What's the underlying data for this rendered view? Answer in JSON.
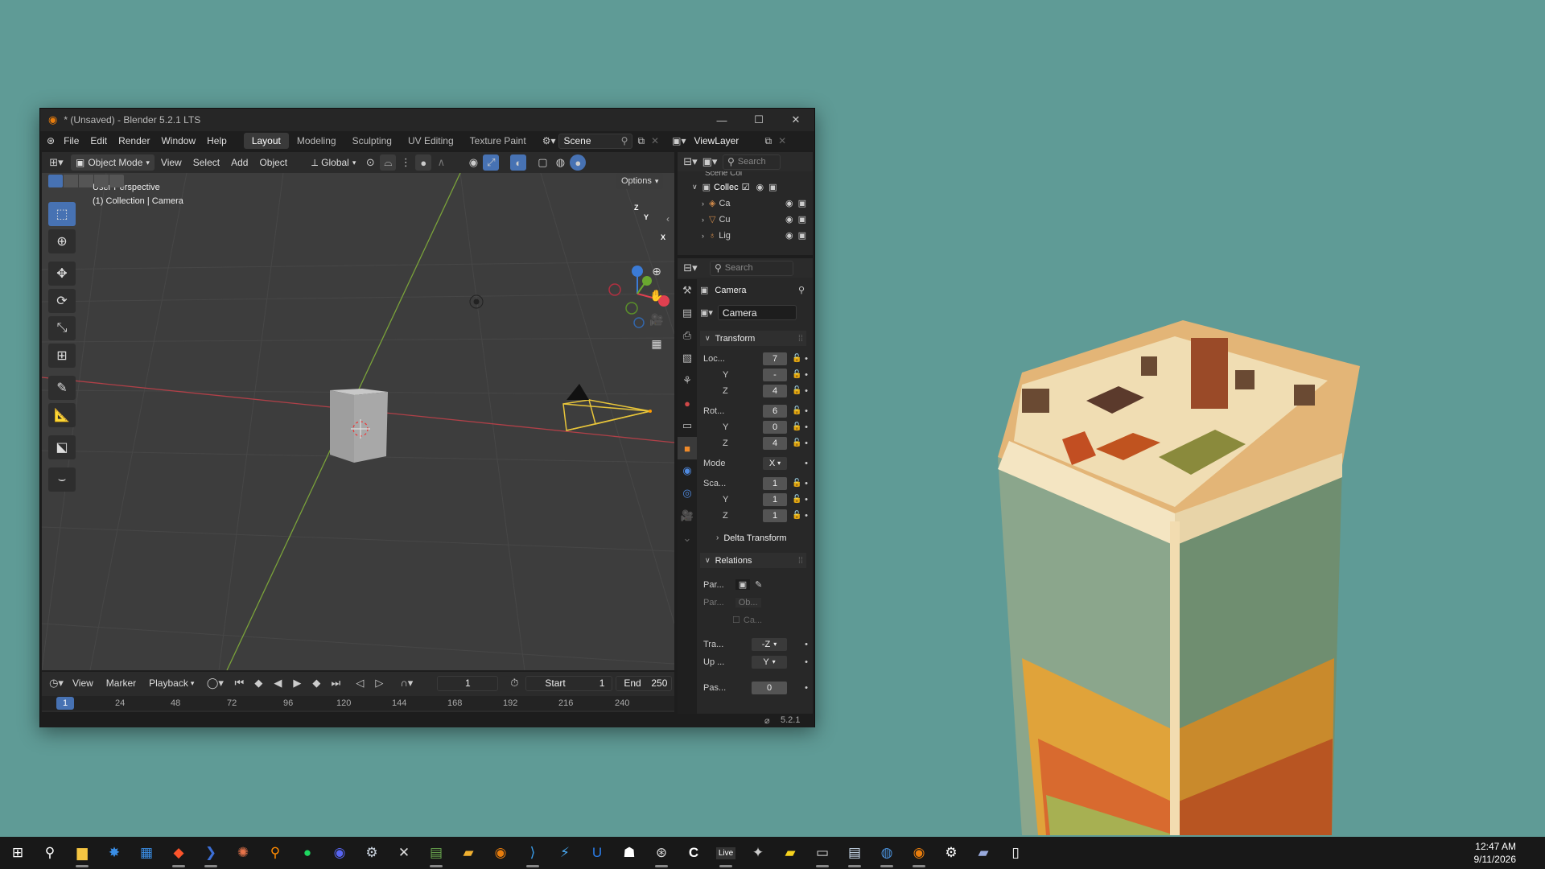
{
  "window": {
    "title": "* (Unsaved) - Blender 5.2.1 LTS",
    "min_icon": "minimize-icon",
    "max_icon": "maximize-icon",
    "close_icon": "close-icon"
  },
  "menubar": {
    "items": [
      "File",
      "Edit",
      "Render",
      "Window",
      "Help"
    ],
    "workspaces": [
      "Layout",
      "Modeling",
      "Sculpting",
      "UV Editing",
      "Texture Paint"
    ],
    "active_workspace": "Layout",
    "scene": "Scene",
    "view_layer": "ViewLayer"
  },
  "viewport_header": {
    "mode": "Object Mode",
    "menus": [
      "View",
      "Select",
      "Add",
      "Object"
    ],
    "orientation": "Global",
    "options": "Options"
  },
  "viewport": {
    "view_name": "User Perspective",
    "collection_info": "(1) Collection | Camera",
    "gizmo": {
      "x": "X",
      "y": "Y",
      "z": "Z"
    }
  },
  "outliner": {
    "search_placeholder": "Search",
    "scene_label": "Scene Col",
    "items": [
      {
        "label": "Collec",
        "icon": "collection-icon"
      },
      {
        "label": "Ca",
        "icon": "camera-icon"
      },
      {
        "label": "Cu",
        "icon": "mesh-icon"
      },
      {
        "label": "Lig",
        "icon": "light-icon"
      }
    ]
  },
  "properties": {
    "search_placeholder": "Search",
    "object_name": "Camera",
    "data_name": "Camera",
    "transform_header": "Transform",
    "location": {
      "label": "Loc...",
      "x": "7",
      "y": "-",
      "z": "4"
    },
    "rotation": {
      "label": "Rot...",
      "x": "6",
      "y": "0",
      "z": "4"
    },
    "mode": {
      "label": "Mode",
      "value": "X"
    },
    "scale": {
      "label": "Sca...",
      "x": "1",
      "y": "1",
      "z": "1"
    },
    "axis_y": "Y",
    "axis_z": "Z",
    "delta_transform": "Delta Transform",
    "relations_header": "Relations",
    "parent_label": "Par...",
    "parent_type_label": "Par...",
    "parent_type_value": "Ob...",
    "camera_parent": "Ca...",
    "track_label": "Tra...",
    "track_value": "-Z",
    "up_label": "Up ...",
    "up_value": "Y",
    "pass_label": "Pas...",
    "pass_value": "0"
  },
  "timeline": {
    "menus": [
      "View",
      "Marker",
      "Playback"
    ],
    "current_frame": "1",
    "start_label": "Start",
    "start_value": "1",
    "end_label": "End",
    "end_value": "250",
    "ticks": [
      "1",
      "24",
      "48",
      "72",
      "96",
      "120",
      "144",
      "168",
      "192",
      "216",
      "240"
    ]
  },
  "statusbar": {
    "version": "5.2.1"
  },
  "taskbar": {
    "time": "12:47 AM",
    "date": "9/11/2026",
    "icons": [
      "windows-start-icon",
      "search-icon",
      "file-explorer-icon",
      "app-icon",
      "app-icon",
      "brave-browser-icon",
      "powershell-icon",
      "app-icon",
      "search-app-icon",
      "spotify-icon",
      "discord-icon",
      "steam-icon",
      "app-icon",
      "app-icon",
      "folder-icon",
      "blender-icon",
      "vscode-icon",
      "app-icon",
      "app-icon",
      "app-icon",
      "app-icon",
      "app-icon",
      "live-icon",
      "app-icon",
      "sticky-notes-icon",
      "terminal-icon",
      "app-icon",
      "app-icon",
      "blender-icon",
      "settings-icon",
      "app-icon",
      "notepad-icon"
    ],
    "live_text": "Live"
  }
}
